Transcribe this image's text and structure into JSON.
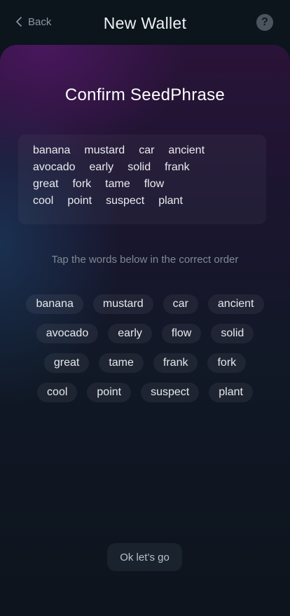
{
  "header": {
    "back_label": "Back",
    "title": "New Wallet",
    "help_glyph": "?"
  },
  "card": {
    "title": "Confirm SeedPhrase",
    "seed_phrase_rows": [
      [
        "banana",
        "mustard",
        "car",
        "ancient"
      ],
      [
        "avocado",
        "early",
        "solid",
        "frank"
      ],
      [
        "great",
        "fork",
        "tame",
        "flow"
      ],
      [
        "cool",
        "point",
        "suspect",
        "plant"
      ]
    ],
    "instruction": "Tap the words below in the correct order",
    "word_chip_rows": [
      [
        "banana",
        "mustard",
        "car",
        "ancient"
      ],
      [
        "avocado",
        "early",
        "flow",
        "solid"
      ],
      [
        "great",
        "tame",
        "frank",
        "fork"
      ],
      [
        "cool",
        "point",
        "suspect",
        "plant"
      ]
    ],
    "confirm_button_label": "Ok let’s go"
  },
  "icons": {
    "back": "chevron-left-icon",
    "help": "question-circle-icon"
  },
  "colors": {
    "background": "#0c141c",
    "card_gradient_top": "#2a1338",
    "chip_background": "rgba(255,255,255,0.06)",
    "muted_text": "#7f8994"
  }
}
